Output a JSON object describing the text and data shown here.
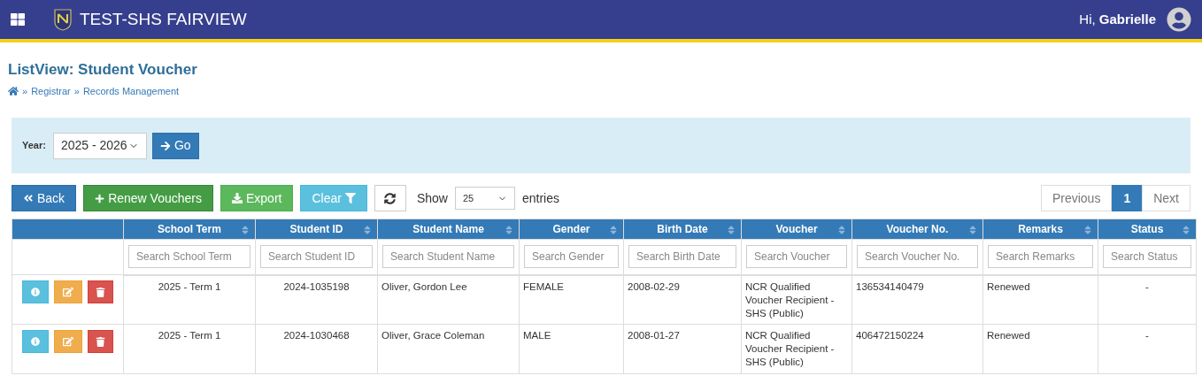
{
  "navbar": {
    "brand": "TEST-SHS FAIRVIEW",
    "greeting": "Hi, **Gabrielle**"
  },
  "page": {
    "title": "ListView: Student Voucher",
    "breadcrumb": [
      {
        "separator": "»",
        "label": "Registrar"
      },
      {
        "separator": "»",
        "label": "Records Management"
      }
    ]
  },
  "filter": {
    "label": "Year:",
    "year": "2025 - 2026",
    "go_button": "Go"
  },
  "toolbar": {
    "buttons": [
      {
        "kind": "back",
        "label": "Back"
      },
      {
        "kind": "renew",
        "label": "Renew Vouchers"
      },
      {
        "kind": "export",
        "label": "Export"
      },
      {
        "kind": "clear",
        "label": "Clear"
      },
      {
        "kind": "refresh"
      }
    ],
    "show_label": "Show",
    "page_size": "25",
    "entries_label": "entries"
  },
  "pagination": [
    {
      "label": "Previous",
      "selected": false
    },
    {
      "label": "1",
      "selected": true
    },
    {
      "label": "Next",
      "selected": false
    }
  ],
  "table": {
    "columns": [
      {
        "title": "School Term",
        "placeholder": "Search School Term",
        "kind": "centered"
      },
      {
        "title": "Student ID",
        "placeholder": "Search Student ID",
        "kind": "centered"
      },
      {
        "title": "Student Name",
        "placeholder": "Search Student Name",
        "kind": "plain"
      },
      {
        "title": "Gender",
        "placeholder": "Search Gender",
        "kind": "plain"
      },
      {
        "title": "Birth Date",
        "placeholder": "Search Birth Date",
        "kind": "plain"
      },
      {
        "title": "Voucher",
        "placeholder": "Search Voucher",
        "kind": "plain"
      },
      {
        "title": "Voucher No.",
        "placeholder": "Search Voucher No.",
        "kind": "plain"
      },
      {
        "title": "Remarks",
        "placeholder": "Search Remarks",
        "kind": "plain"
      },
      {
        "title": "Status",
        "placeholder": "Search Status",
        "kind": "centered"
      }
    ],
    "rows": [
      [
        "2025 - Term 1",
        "2024-1035198",
        "Oliver, Gordon Lee",
        "FEMALE",
        "2008-02-29",
        "NCR Qualified Voucher Recipient - SHS (Public)",
        "136534140479",
        "Renewed",
        "-"
      ],
      [
        "2025 - Term 1",
        "2024-1030468",
        "Oliver, Grace Coleman",
        "MALE",
        "2008-01-27",
        "NCR Qualified Voucher Recipient - SHS (Public)",
        "406472150224",
        "Renewed",
        "-"
      ]
    ]
  }
}
